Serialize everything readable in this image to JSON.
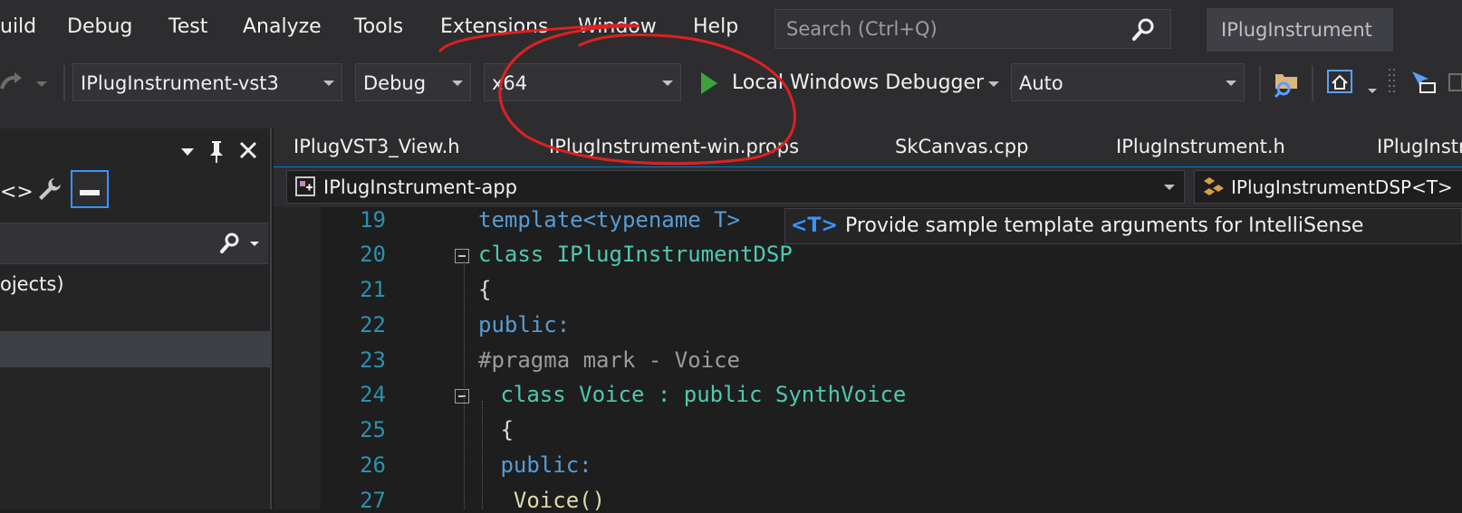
{
  "menubar": {
    "items": [
      "uild",
      "Debug",
      "Test",
      "Analyze",
      "Tools",
      "Extensions",
      "Window",
      "Help"
    ],
    "search_placeholder": "Search (Ctrl+Q)",
    "solution_name": "IPlugInstrument"
  },
  "toolbar": {
    "startup_project": "IPlugInstrument-vst3",
    "configuration": "Debug",
    "platform": "x64",
    "debugger": "Local Windows Debugger",
    "debugger_mode": "Auto"
  },
  "left_panel": {
    "item_text": "ojects)"
  },
  "tabs": [
    "IPlugVST3_View.h",
    "IPlugInstrument-win.props",
    "SkCanvas.cpp",
    "IPlugInstrument.h",
    "IPlugInstr"
  ],
  "navbar": {
    "project": "IPlugInstrument-app",
    "class": "IPlugInstrumentDSP<T>"
  },
  "editor": {
    "lines": [
      {
        "num": "19",
        "text": "template<typename T>"
      },
      {
        "num": "20",
        "text": "class IPlugInstrumentDSP"
      },
      {
        "num": "21",
        "text": "{"
      },
      {
        "num": "22",
        "text": "public:"
      },
      {
        "num": "23",
        "text": "#pragma mark - Voice"
      },
      {
        "num": "24",
        "text": " class Voice : public SynthVoice"
      },
      {
        "num": "25",
        "text": " {"
      },
      {
        "num": "26",
        "text": " public:"
      },
      {
        "num": "27",
        "text": "  Voice()"
      }
    ],
    "hint_badge": "<T>",
    "hint_text": "Provide sample template arguments for IntelliSense"
  },
  "colors": {
    "accent": "#007acc",
    "annotation": "#e02020"
  }
}
